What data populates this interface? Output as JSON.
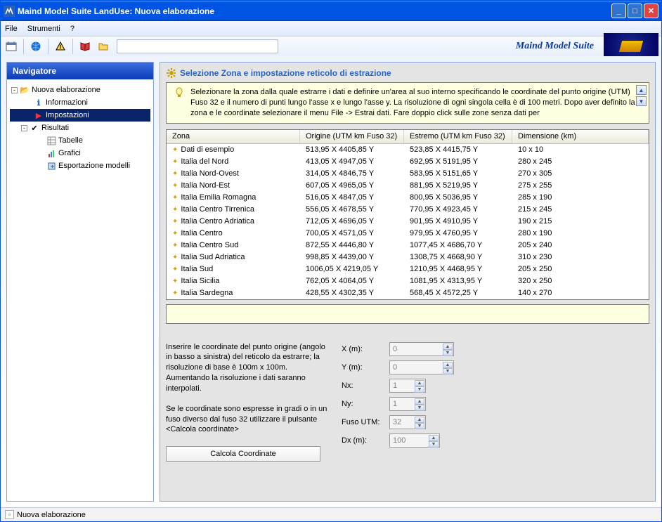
{
  "window": {
    "title": "Maind Model Suite LandUse: Nuova elaborazione"
  },
  "menubar": {
    "file": "File",
    "tools": "Strumenti",
    "help": "?"
  },
  "brand": "Maind Model Suite",
  "navigator": {
    "title": "Navigatore",
    "root": "Nuova elaborazione",
    "items": {
      "info": "Informazioni",
      "settings": "Impostazioni",
      "results": "Risultati",
      "tables": "Tabelle",
      "charts": "Grafici",
      "export": "Esportazione modelli"
    }
  },
  "section": {
    "title": "Selezione Zona e impostazione reticolo di estrazione",
    "help": "Selezionare la zona dalla quale estrarre i dati e definire un'area al suo interno specificando le coordinate del punto origine (UTM) Fuso 32 e il numero di punti lungo l'asse x e lungo l'asse y. La risoluzione di ogni singola cella è di 100 metri. Dopo aver definito la zona e le coordinate selezionare il menu File -> Estrai dati. Fare doppio click sulle zone senza dati per"
  },
  "table": {
    "headers": {
      "zona": "Zona",
      "orig": "Origine (UTM km Fuso 32)",
      "estr": "Estremo (UTM km Fuso 32)",
      "dim": "Dimensione (km)"
    },
    "rows": [
      {
        "zona": "Dati di esempio",
        "orig": "513,95 X 4405,85 Y",
        "estr": "523,85 X 4415,75 Y",
        "dim": "10 x 10"
      },
      {
        "zona": "Italia del Nord",
        "orig": "413,05 X 4947,05 Y",
        "estr": "692,95 X 5191,95 Y",
        "dim": "280 x 245"
      },
      {
        "zona": "Italia Nord-Ovest",
        "orig": "314,05 X 4846,75 Y",
        "estr": "583,95 X 5151,65 Y",
        "dim": "270 x 305"
      },
      {
        "zona": "Italia Nord-Est",
        "orig": "607,05 X 4965,05 Y",
        "estr": "881,95 X 5219,95 Y",
        "dim": "275 x 255"
      },
      {
        "zona": "Italia Emilia Romagna",
        "orig": "516,05 X 4847,05 Y",
        "estr": "800,95 X 5036,95 Y",
        "dim": "285 x 190"
      },
      {
        "zona": "Italia Centro Tirrenica",
        "orig": "556,05 X 4678,55 Y",
        "estr": "770,95 X 4923,45 Y",
        "dim": "215 x 245"
      },
      {
        "zona": "Italia Centro Adriatica",
        "orig": "712,05 X 4696,05 Y",
        "estr": "901,95 X 4910,95 Y",
        "dim": "190 x 215"
      },
      {
        "zona": "Italia Centro",
        "orig": "700,05 X 4571,05 Y",
        "estr": "979,95 X 4760,95 Y",
        "dim": "280 x 190"
      },
      {
        "zona": "Italia Centro Sud",
        "orig": "872,55 X 4446,80 Y",
        "estr": "1077,45 X 4686,70 Y",
        "dim": "205 x 240"
      },
      {
        "zona": "Italia Sud Adriatica",
        "orig": "998,85 X 4439,00 Y",
        "estr": "1308,75 X 4668,90 Y",
        "dim": "310 x 230"
      },
      {
        "zona": "Italia Sud",
        "orig": "1006,05 X 4219,05 Y",
        "estr": "1210,95 X 4468,95 Y",
        "dim": "205 x 250"
      },
      {
        "zona": "Italia Sicilia",
        "orig": "762,05 X 4064,05 Y",
        "estr": "1081,95 X 4313,95 Y",
        "dim": "320 x 250"
      },
      {
        "zona": "Italia Sardegna",
        "orig": "428,55 X 4302,35 Y",
        "estr": "568,45 X 4572,25 Y",
        "dim": "140 x 270"
      }
    ]
  },
  "coord": {
    "text1": "Inserire le coordinate del punto origine (angolo in basso a sinistra) del reticolo da estrarre; la risoluzione di base è 100m x 100m. Aumentando la risoluzione i dati saranno interpolati.",
    "text2": "Se le coordinate sono espresse in gradi o in un fuso diverso dal fuso 32 utilizzare il pulsante <Calcola coordinate>",
    "calc_btn": "Calcola Coordinate",
    "labels": {
      "x": "X (m):",
      "y": "Y (m):",
      "nx": "Nx:",
      "ny": "Ny:",
      "fuso": "Fuso UTM:",
      "dx": "Dx (m):"
    },
    "values": {
      "x": "0",
      "y": "0",
      "nx": "1",
      "ny": "1",
      "fuso": "32",
      "dx": "100"
    }
  },
  "statusbar": {
    "text": "Nuova elaborazione"
  }
}
